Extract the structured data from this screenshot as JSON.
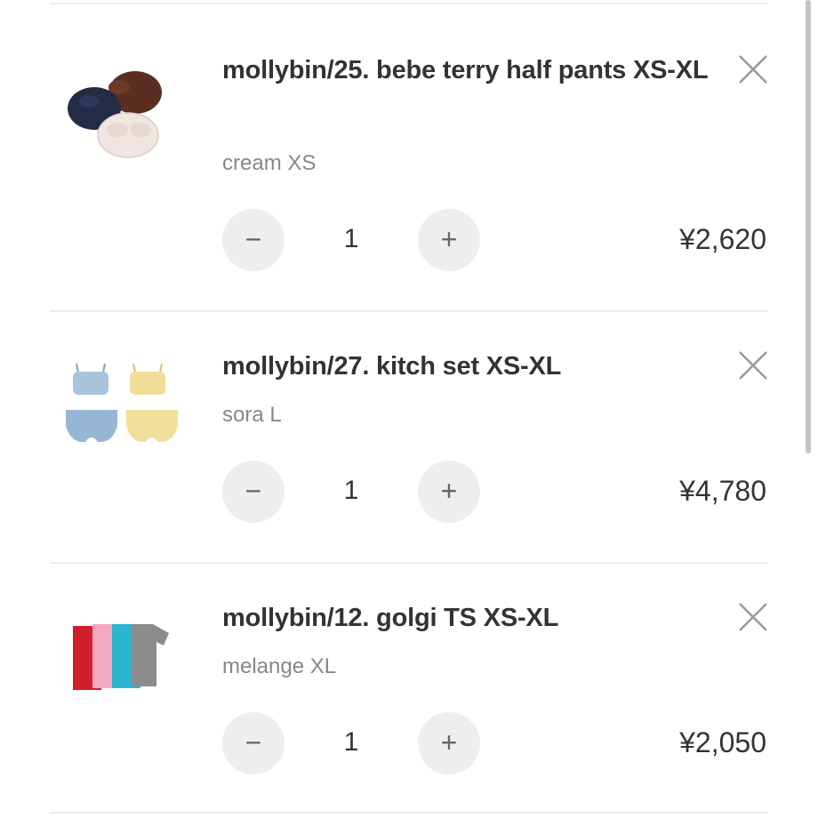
{
  "cart": {
    "items": [
      {
        "title": "mollybin/25. bebe terry half pants XS-XL",
        "variant": "cream XS",
        "quantity": "1",
        "price": "¥2,620",
        "minus_label": "−",
        "plus_label": "+"
      },
      {
        "title": "mollybin/27. kitch set XS-XL",
        "variant": "sora L",
        "quantity": "1",
        "price": "¥4,780",
        "minus_label": "−",
        "plus_label": "+"
      },
      {
        "title": "mollybin/12. golgi TS XS-XL",
        "variant": "melange XL",
        "quantity": "1",
        "price": "¥2,050",
        "minus_label": "−",
        "plus_label": "+"
      }
    ]
  },
  "icons": {
    "remove": "close-icon",
    "decrease": "minus-icon",
    "increase": "plus-icon"
  },
  "colors": {
    "background": "#ffffff",
    "divider": "#ececec",
    "button_bg": "#eeeeee",
    "variant_text": "#888888",
    "title_text": "#333333"
  }
}
